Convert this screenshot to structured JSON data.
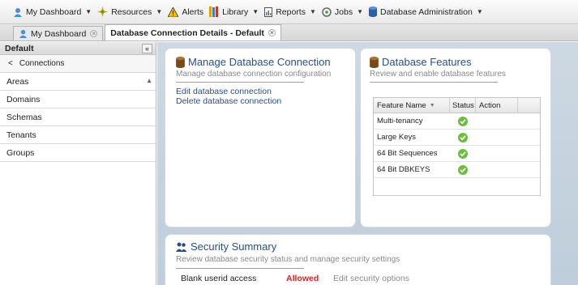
{
  "menubar": {
    "items": [
      {
        "label": "My Dashboard",
        "icon": "user-icon",
        "has_caret": true
      },
      {
        "label": "Resources",
        "icon": "resources-icon",
        "has_caret": true
      },
      {
        "label": "Alerts",
        "icon": "warning-icon",
        "has_caret": false
      },
      {
        "label": "Library",
        "icon": "library-icon",
        "has_caret": true
      },
      {
        "label": "Reports",
        "icon": "reports-icon",
        "has_caret": true
      },
      {
        "label": "Jobs",
        "icon": "jobs-icon",
        "has_caret": true
      },
      {
        "label": "Database Administration",
        "icon": "database-icon",
        "has_caret": true
      }
    ]
  },
  "tabs": [
    {
      "label": "My Dashboard",
      "active": false
    },
    {
      "label": "Database Connection Details - Default",
      "active": true
    }
  ],
  "sidebar": {
    "header": "Default",
    "sub_header": "Connections",
    "items": [
      {
        "label": "Areas"
      },
      {
        "label": "Domains"
      },
      {
        "label": "Schemas"
      },
      {
        "label": "Tenants"
      },
      {
        "label": "Groups"
      }
    ]
  },
  "manage_panel": {
    "title": "Manage Database Connection",
    "subtitle": "Manage database connection configuration",
    "links": [
      {
        "label": "Edit database connection"
      },
      {
        "label": "Delete database connection"
      }
    ]
  },
  "features_panel": {
    "title": "Database Features",
    "subtitle": "Review and enable database features",
    "columns": [
      "Feature Name",
      "Status",
      "Action"
    ],
    "rows": [
      {
        "name": "Multi-tenancy",
        "status": "enabled"
      },
      {
        "name": "Large Keys",
        "status": "enabled"
      },
      {
        "name": "64 Bit Sequences",
        "status": "enabled"
      },
      {
        "name": "64 Bit DBKEYS",
        "status": "enabled"
      }
    ]
  },
  "security_panel": {
    "title": "Security Summary",
    "subtitle": "Review database security status and manage security settings",
    "rows": [
      {
        "label": "Blank userid access",
        "value": "Allowed",
        "action": "Edit security options"
      }
    ]
  },
  "colors": {
    "link": "#2a4f82",
    "allowed": "#e02020",
    "check": "#6abf3b",
    "content_bg": "#c7d3de"
  }
}
